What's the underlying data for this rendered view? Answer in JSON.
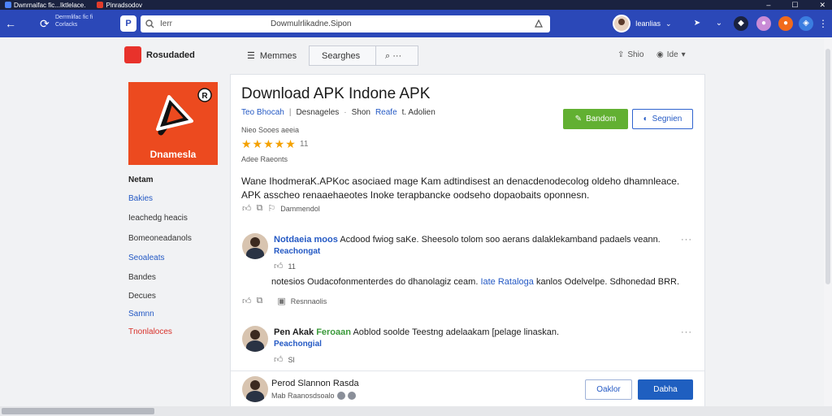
{
  "window": {
    "tabs": [
      {
        "label": "Dwnrnaifac fic...Iktlelace."
      },
      {
        "label": "Pinradsodov"
      }
    ],
    "controls": {
      "min": "–",
      "max": "☐",
      "close": "✕"
    }
  },
  "browser": {
    "tab_title": "Derrmlifac fic fi\nCorlacks",
    "url_left": "Ierr",
    "url": "Dowmulrlikadne.Sipon",
    "profile_name": "Ieanlias",
    "profile_caret": "⌄"
  },
  "header": {
    "brand": "Rosudaded",
    "menu_label": "Memmes",
    "search_label": "Searghes",
    "search_more": "···",
    "right1": "Shio",
    "right2": "Ide"
  },
  "sidebar": {
    "tile_label": "Dnamesla",
    "tile_badge": "R",
    "items": [
      {
        "label": "Netam",
        "style": "bold"
      },
      {
        "label": "Bakies",
        "style": "blue"
      },
      {
        "label": "Ieachedg heacis",
        "style": "plain"
      },
      {
        "label": "Bomeoneadanols",
        "style": "plain"
      },
      {
        "label": "Seoaleats",
        "style": "blue"
      },
      {
        "label": "Bandes",
        "style": "plain"
      },
      {
        "label": "Decues",
        "style": "plain"
      },
      {
        "label": "Samnn",
        "style": "blue"
      },
      {
        "label": "Tnonlaloces",
        "style": "red"
      }
    ]
  },
  "app": {
    "title": "Download APK Indone APK",
    "developer": "Teo Bhocah",
    "meta_sep": "|",
    "category": "Desnageles",
    "bullet": "·",
    "platform_prefix": "Shon",
    "platform": "Reafe",
    "age": "t. Adolien",
    "stats_line": "Nieo Sooes aeeia",
    "stars": "★★★★★",
    "rating": "11",
    "reviews_label": "Adee Raeonts",
    "download_label": "Bandom",
    "register_label": "Segnien",
    "description": "Wane IhodmeraK.APKoc asociaed mage Kam adtindisest an denacdenodecolog oldeho dhamnleace. APK asscheo renaaehaeotes Inoke terapbancke oodseho dopaobaits oponnesn.",
    "like_count": "",
    "report_label": "Dammendol"
  },
  "comments": [
    {
      "author": "Notdaeia moos",
      "text": "Acdood fwiog saKe. Sheesolo tolom soo aerans dalaklekamband padaels veann.",
      "reply_label": "Reachongat",
      "likes": "11",
      "more": "···"
    },
    {
      "author": "",
      "text_prefix": "notesios Oudacofonmenterdes do dhanolagiz ceam. ",
      "mention": "Iate Rataloga",
      "text_suffix": " kanlos Odelvelpe. Sdhonedad BRR.",
      "action_label": "Resnnaolis"
    },
    {
      "author": "Pen Akak",
      "badge": "Feroaan",
      "text": "Aoblod soolde Teestng adelaakam [pelage linaskan.",
      "reply_label": "Peachongial",
      "likes": "Sl",
      "more": "···"
    }
  ],
  "composer": {
    "name": "Perod Slannon Rasda",
    "sub": "Mab Raanosdsoalo",
    "cancel_label": "Oaklor",
    "submit_label": "Dabha"
  },
  "colors": {
    "nav": "#2b48b8",
    "accent_green": "#62b032",
    "accent_blue": "#1f5fc0",
    "tile": "#ec4a1f"
  }
}
